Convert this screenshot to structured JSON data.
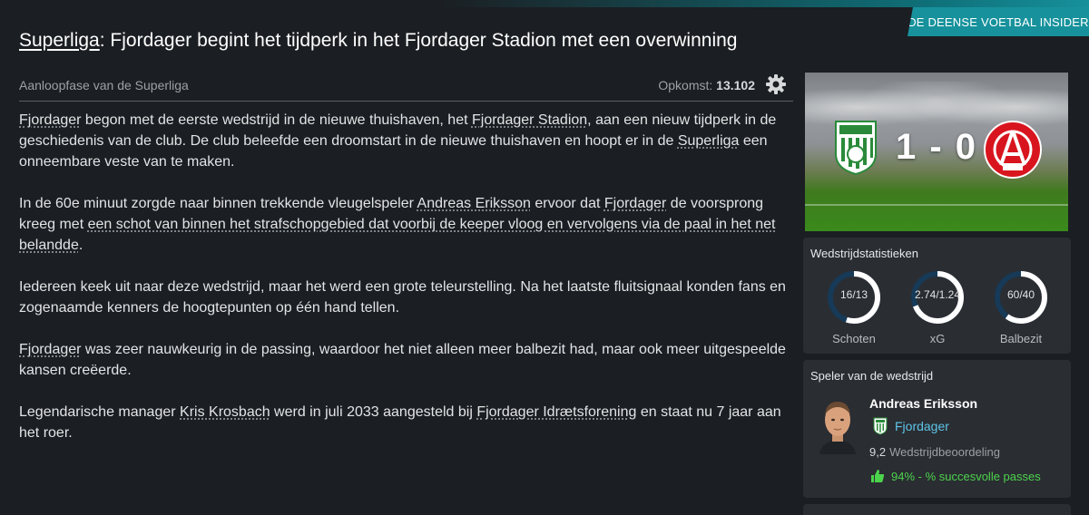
{
  "header": {
    "tag": "DE DEENSE VOETBAL INSIDER",
    "headline_league": "Superliga",
    "headline_rest": ": Fjordager begint het tijdperk in het Fjordager Stadion met een overwinning",
    "subtitle": "Aanloopfase van de Superliga",
    "attendance_label": "Opkomst:",
    "attendance_value": "13.102"
  },
  "article": {
    "p1": {
      "a": "Fjordager",
      "b": " begon met de eerste wedstrijd in de nieuwe thuishaven, het ",
      "c": "Fjordager Stadion",
      "d": ", aan een nieuw tijdperk in de geschiedenis van de club. De club beleefde een droomstart in de nieuwe thuishaven en hoopt er in de ",
      "e": "Superliga",
      "f": " een onneembare veste van te maken."
    },
    "p2": {
      "a": "In de 60e minuut zorgde naar binnen trekkende vleugelspeler ",
      "b": "Andreas Eriksson",
      "c": " ervoor dat ",
      "d": "Fjordager",
      "e": " de voorsprong kreeg met ",
      "f": "een schot van binnen het strafschopgebied dat voorbij de keeper vloog en vervolgens via de paal in het net belandde",
      "g": "."
    },
    "p3": "Iedereen keek uit naar deze wedstrijd, maar het werd een grote teleurstelling. Na het laatste fluitsignaal konden fans en zogenaamde kenners de hoogtepunten op één hand tellen.",
    "p4": {
      "a": "Fjordager",
      "b": " was zeer nauwkeurig in de passing, waardoor het niet alleen meer balbezit had, maar ook meer uitgespeelde kansen creëerde."
    },
    "p5": {
      "a": "Legendarische manager ",
      "b": "Kris Krosbach",
      "c": " werd in juli 2033 aangesteld bij ",
      "d": "Fjordager Idrætsforening",
      "e": " en staat nu 7 jaar aan het roer."
    }
  },
  "scoreboard": {
    "score": "1 - 0",
    "home_crest_icon": "fjordager-crest-icon",
    "away_crest_icon": "away-club-crest-icon"
  },
  "stats": {
    "title": "Wedstrijdstatistieken",
    "items": [
      {
        "label": "Schoten",
        "value": "16/13",
        "home_share": 0.55
      },
      {
        "label": "xG",
        "value": "2.74/1.24",
        "home_share": 0.69
      },
      {
        "label": "Balbezit",
        "value": "60/40",
        "home_share": 0.6
      }
    ],
    "colors": {
      "home": "#ffffff",
      "away": "#163a57"
    }
  },
  "potm": {
    "title": "Speler van de wedstrijd",
    "name": "Andreas Eriksson",
    "club": "Fjordager",
    "rating": "9,2",
    "rating_label": "Wedstrijdbeoordeling",
    "passes": "94% - % succesvolle passes"
  }
}
